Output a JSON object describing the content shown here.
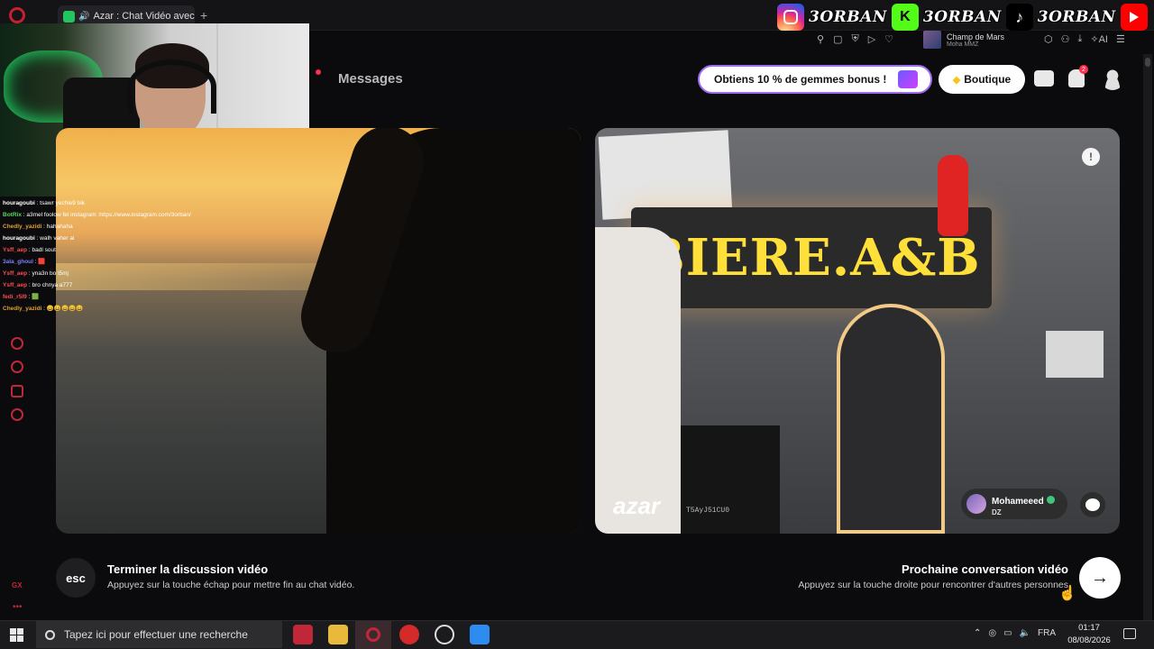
{
  "browser": {
    "tab_title": "Azar : Chat Vidéo avec",
    "new_tab": "+",
    "music_title": "Champ de Mars",
    "music_artist": "Moha MMZ",
    "ai_label": "AI"
  },
  "overlay": {
    "social_handle_1": "3ORBAN",
    "social_handle_2": "3ORBAN",
    "social_handle_3": "3ORBAN",
    "kick_letter": "K",
    "chat": [
      {
        "user": "houragoubi",
        "user_color": "#ffffff",
        "text": " : tsawr yechie9 bik"
      },
      {
        "user": "BotRix",
        "user_color": "#5fd35f",
        "text": " : a3mel foolow fel instagram :https://www.instagram.com/3orban/"
      },
      {
        "user": "Chedly_yazidi",
        "user_color": "#e0a030",
        "text": " : hahahaha"
      },
      {
        "user": "houragoubi",
        "user_color": "#ffffff",
        "text": " : walh vaher ai"
      },
      {
        "user": "Ysff_aep",
        "user_color": "#ff4d4d",
        "text": " : badl sout"
      },
      {
        "user": "3ala_ghoul",
        "user_color": "#7f7fff",
        "text": " : 🟥"
      },
      {
        "user": "Ysff_aep",
        "user_color": "#ff4d4d",
        "text": " : yna3n bo l5mj"
      },
      {
        "user": "Ysff_aep",
        "user_color": "#ff4d4d",
        "text": " : bro chnya a777"
      },
      {
        "user": "fedi_r5l9",
        "user_color": "#ff4d4d",
        "text": " : 🟩"
      },
      {
        "user": "Chedly_yazidi",
        "user_color": "#e0a030",
        "text": " : 😄😄😄😄😄"
      }
    ],
    "gx_label": "GX",
    "more_dots": "•••"
  },
  "azar": {
    "nav_messages": "Messages",
    "promo_text": "Obtiens 10 % de gemmes bonus !",
    "boutique_label": "Boutique",
    "notif_count": "2",
    "logo": "azar",
    "partner_id": "T5AyJ51CU0",
    "partner_name": "Mohameeed",
    "partner_country": "DZ",
    "sign_text": "BIERE.A&B",
    "esc_key": "esc",
    "end_title": "Terminer la discussion vidéo",
    "end_sub": "Appuyez sur la touche échap pour mettre fin au chat vidéo.",
    "next_title": "Prochaine conversation vidéo",
    "next_sub": "Appuyez sur la touche droite pour rencontrer d'autres personnes",
    "next_arrow": "→",
    "report_icon": "!"
  },
  "taskbar": {
    "search_placeholder": "Tapez ici pour effectuer une recherche",
    "lang": "FRA",
    "time": "01:17",
    "date": "08/08/2026"
  },
  "colors": {
    "accent_red": "#c0283a",
    "promo_border": "#a06cf0"
  }
}
